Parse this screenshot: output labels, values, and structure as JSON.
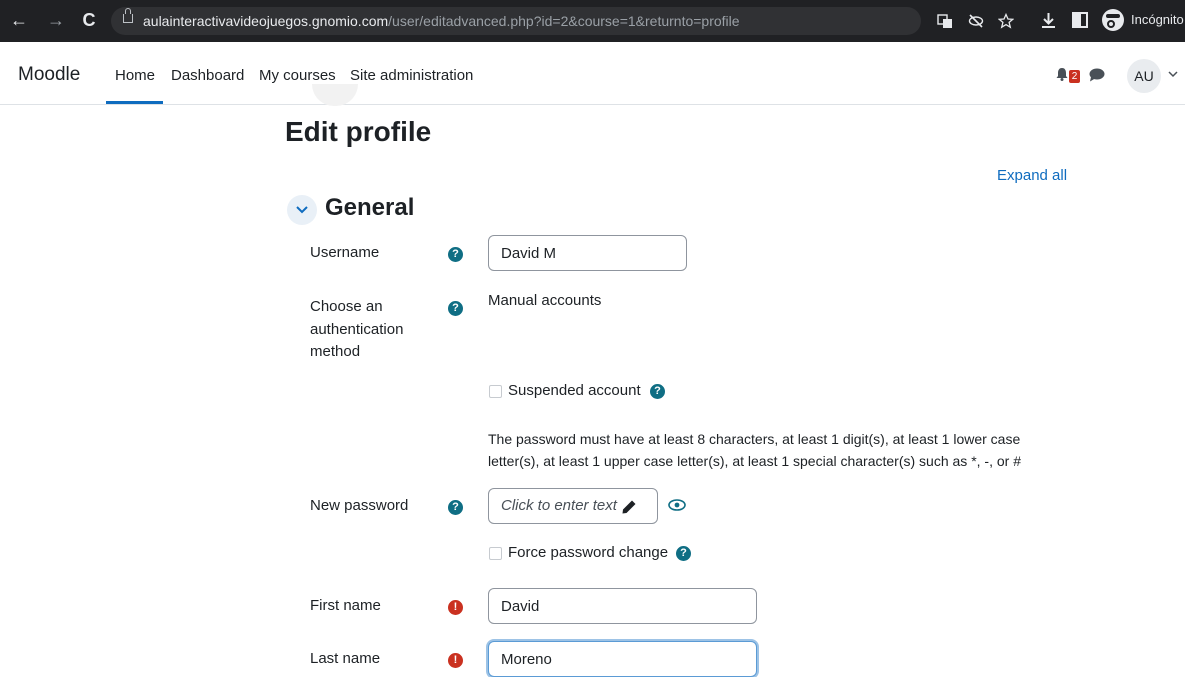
{
  "browser": {
    "url_host": "aulainteractivavideojuegos.gnomio.com",
    "url_path": "/user/editadvanced.php?id=2&course=1&returnto=profile",
    "incognito_label": "Incógnito",
    "back_glyph": "←",
    "forward_glyph": "→",
    "reload_glyph": "C",
    "icons": [
      "translate-icon",
      "eye-off-icon",
      "star-icon",
      "download-icon",
      "sidebar-icon",
      "incognito-icon"
    ]
  },
  "navbar": {
    "brand": "Moodle",
    "links": [
      "Home",
      "Dashboard",
      "My courses",
      "Site administration"
    ],
    "active_link": "Home",
    "notification_count": "2",
    "avatar_initials": "AU"
  },
  "page": {
    "title": "Edit profile",
    "expand_all": "Expand all",
    "section_title": "General"
  },
  "form": {
    "username_label": "Username",
    "username_value": "David M",
    "auth_label": "Choose an authentication method",
    "auth_value": "Manual accounts",
    "suspended_label": "Suspended account",
    "password_rules": "The password must have at least 8 characters, at least 1 digit(s), at least 1 lower case letter(s), at least 1 upper case letter(s), at least 1 special character(s) such as *, -, or #",
    "new_password_label": "New password",
    "new_password_placeholder": "Click to enter text",
    "force_change_label": "Force password change",
    "first_name_label": "First name",
    "first_name_value": "David",
    "last_name_label": "Last name",
    "last_name_value": "Moreno"
  },
  "colors": {
    "accent": "#0f6cbf",
    "help_icon": "#0f6e84",
    "required_icon": "#ca3120"
  }
}
